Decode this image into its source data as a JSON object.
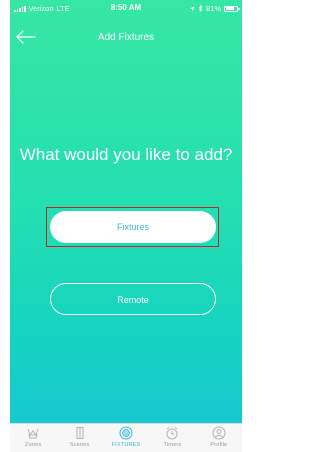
{
  "status_bar": {
    "carrier": "Verizon",
    "network": "LTE",
    "time": "8:50 AM",
    "battery": "81%",
    "battery_level": 0.81
  },
  "nav": {
    "title": "Add Fixtures",
    "back_icon": "arrow-left-icon"
  },
  "main": {
    "prompt": "What would you like to add?",
    "options": [
      {
        "label": "Fixtures",
        "style": "filled"
      },
      {
        "label": "Remote",
        "style": "outline"
      }
    ]
  },
  "tab_bar": {
    "items": [
      {
        "label": "Zones",
        "icon": "zones-icon",
        "active": false
      },
      {
        "label": "Scenes",
        "icon": "scenes-icon",
        "active": false
      },
      {
        "label": "FIXTURES",
        "icon": "fixtures-icon",
        "active": true
      },
      {
        "label": "Timers",
        "icon": "timer-icon",
        "active": false
      },
      {
        "label": "Profile",
        "icon": "profile-icon",
        "active": false
      }
    ]
  },
  "colors": {
    "gradient_top": "#36e6a4",
    "gradient_bottom": "#19c4d4",
    "accent": "#3ab9d9",
    "highlight_box": "#c0262c"
  }
}
